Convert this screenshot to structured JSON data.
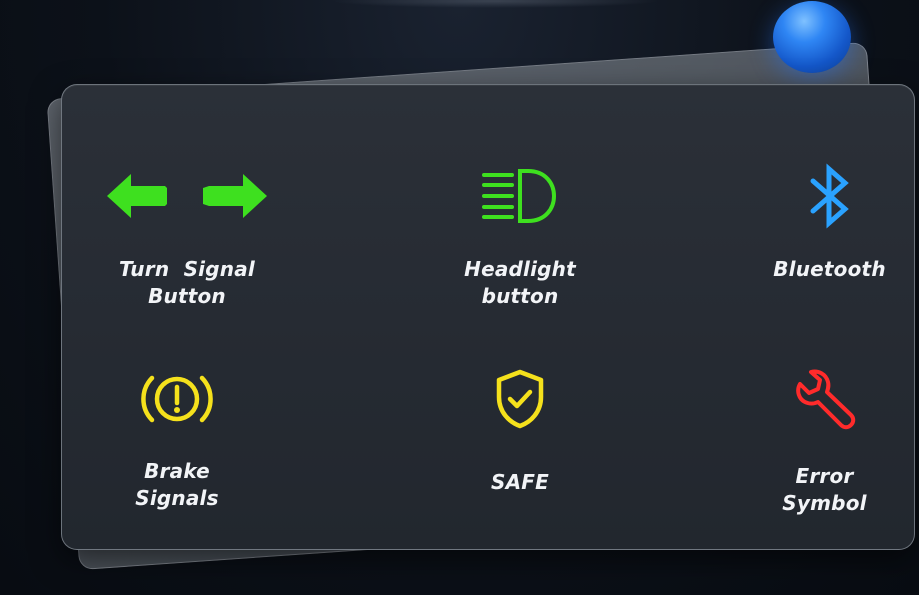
{
  "panel": {
    "items": [
      {
        "label": "Turn  Signal\nButton",
        "icon": "turn-signal-arrows-icon",
        "color": "#3ee01f"
      },
      {
        "label": "Headlight\nbutton",
        "icon": "headlight-icon",
        "color": "#3ee01f"
      },
      {
        "label": "Bluetooth",
        "icon": "bluetooth-icon",
        "color": "#2aa2ff"
      },
      {
        "label": "Brake\nSignals",
        "icon": "brake-warning-icon",
        "color": "#f5e11c"
      },
      {
        "label": "SAFE",
        "icon": "shield-check-icon",
        "color": "#f5e11c"
      },
      {
        "label": "Error\nSymbol",
        "icon": "wrench-icon",
        "color": "#ff2b2b"
      }
    ]
  },
  "colors": {
    "green": "#3ee01f",
    "blue": "#2aa2ff",
    "yellow": "#f5e11c",
    "red": "#ff2b2b",
    "label": "#f2f4f7",
    "card": "#262b33",
    "background": "#0b1018"
  }
}
